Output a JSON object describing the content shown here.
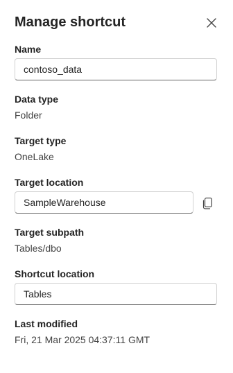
{
  "dialog": {
    "title": "Manage shortcut",
    "close_icon": "close-icon"
  },
  "fields": {
    "name": {
      "label": "Name",
      "value": "contoso_data"
    },
    "data_type": {
      "label": "Data type",
      "value": "Folder"
    },
    "target_type": {
      "label": "Target type",
      "value": "OneLake"
    },
    "target_location": {
      "label": "Target location",
      "value": "SampleWarehouse",
      "copy_icon": "copy-icon"
    },
    "target_subpath": {
      "label": "Target subpath",
      "value": "Tables/dbo"
    },
    "shortcut_location": {
      "label": "Shortcut location",
      "value": "Tables"
    },
    "last_modified": {
      "label": "Last modified",
      "value": "Fri, 21 Mar 2025 04:37:11 GMT"
    }
  }
}
